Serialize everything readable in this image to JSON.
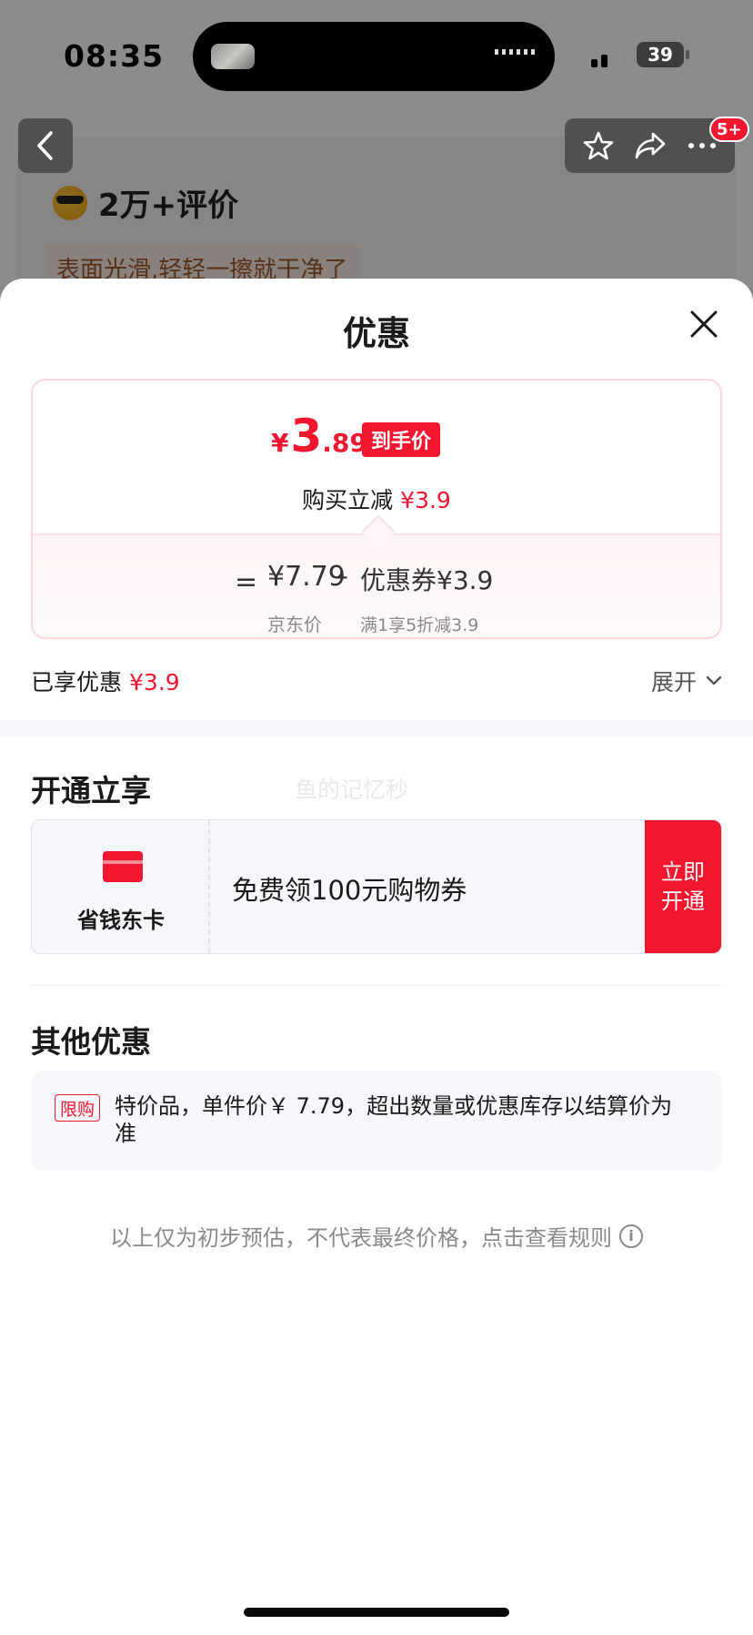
{
  "status_bar": {
    "time": "08:35",
    "battery": "39"
  },
  "background": {
    "rating_text": "2万+评价",
    "tag_text": "表面光滑,轻轻一擦就干净了",
    "badge": "5+"
  },
  "sheet": {
    "title": "优惠",
    "final_price": {
      "symbol": "¥",
      "integer": "3",
      "decimal": ".89",
      "tag": "到手价"
    },
    "reduce": {
      "label": "购买立减",
      "amount": "¥3.9"
    },
    "breakdown": {
      "equals": "=",
      "jd_price": "¥7.79",
      "jd_label": "京东价",
      "minus": "–",
      "coupon": "优惠券¥3.9",
      "coupon_rule": "满1享5折减3.9"
    },
    "enjoyed": {
      "label": "已享优惠",
      "amount": "¥3.9"
    },
    "expand_label": "展开",
    "open_section": {
      "title": "开通立享",
      "watermark": "鱼的记忆秒",
      "card_name": "省钱东卡",
      "card_desc": "免费领100元购物券",
      "button_label": "立即开通"
    },
    "other_section": {
      "title": "其他优惠",
      "tag": "限购",
      "text": "特价品，单件价￥ 7.79，超出数量或优惠库存以结算价为准"
    },
    "disclaimer": "以上仅为初步预估，不代表最终价格，点击查看规则"
  },
  "colors": {
    "accent": "#f2162f",
    "muted": "#8a8a8a",
    "text": "#1a1a1a"
  }
}
